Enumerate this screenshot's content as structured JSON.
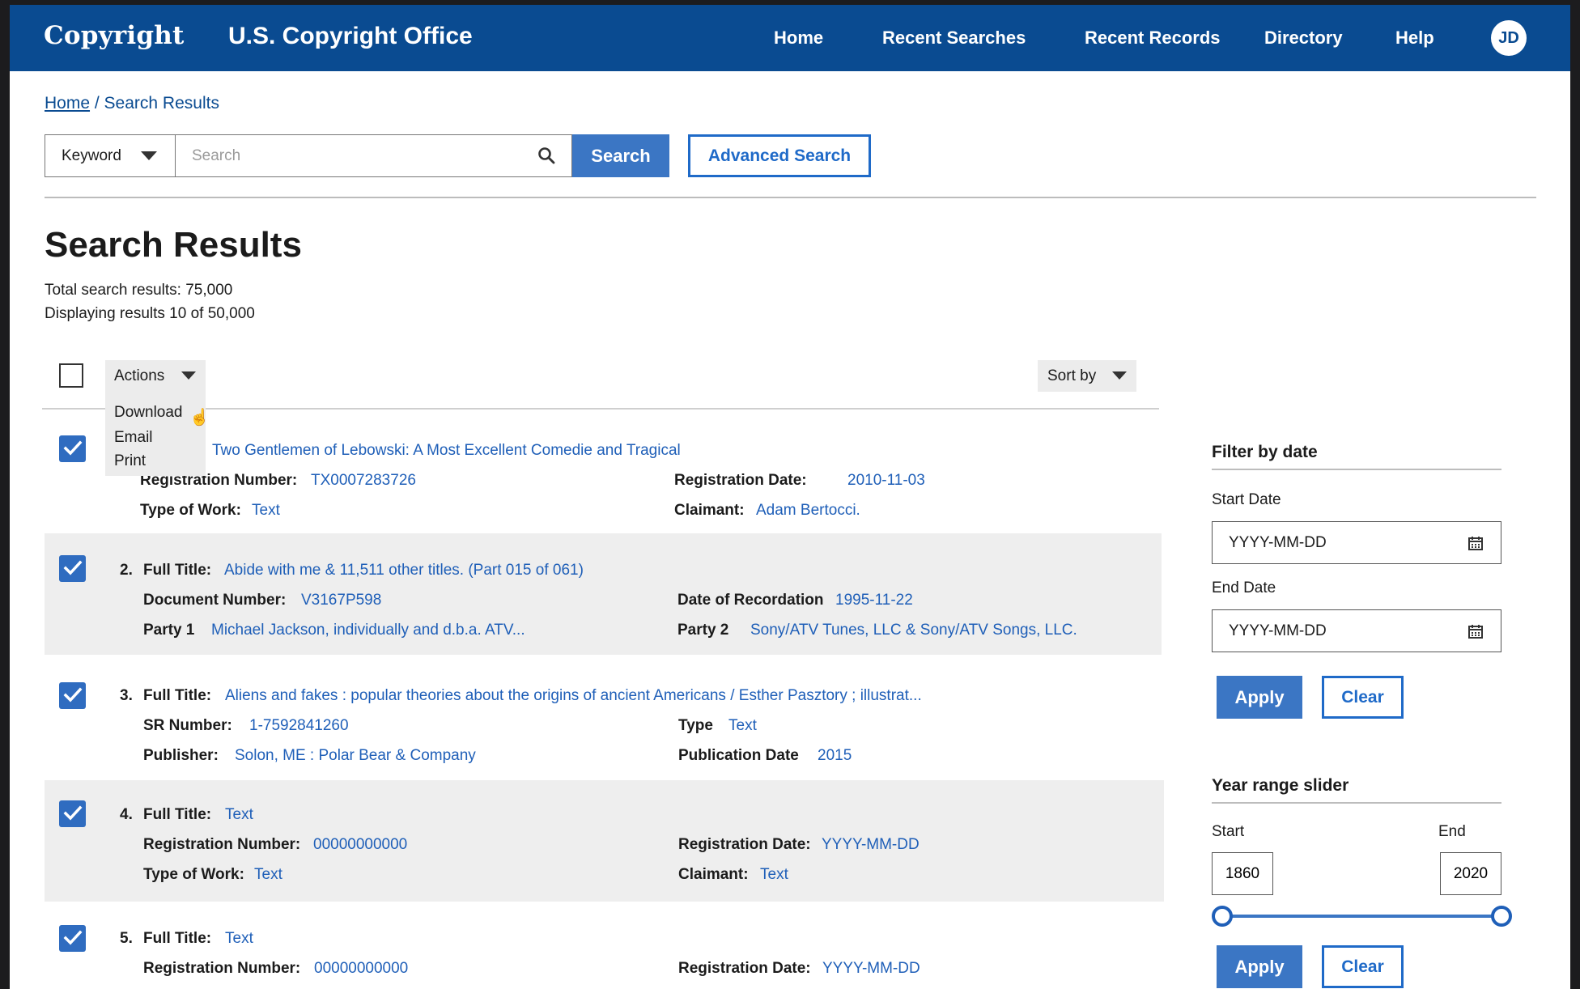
{
  "header": {
    "logo": "Copyright",
    "office": "U.S. Copyright Office",
    "nav": [
      "Home",
      "Recent Searches",
      "Recent Records",
      "Directory",
      "Help"
    ],
    "avatar": "JD",
    "color": "#0a4b91"
  },
  "breadcrumb": {
    "home": "Home",
    "current": "/ Search Results"
  },
  "search": {
    "type": "Keyword",
    "placeholder": "Search",
    "button": "Search",
    "advanced": "Advanced Search"
  },
  "page": {
    "title": "Search Results",
    "total": "Total search results: 75,000",
    "displaying": "Displaying results 10 of 50,000"
  },
  "toolbar": {
    "actions": "Actions",
    "menu": [
      "Download",
      "Email",
      "Print"
    ],
    "sort": "Sort by"
  },
  "results": [
    {
      "title": "Two Gentlemen of Lebowski: A Most Excellent Comedie and Tragical",
      "f1l": "Registration Number:",
      "f1v": "TX0007283726",
      "f2l": "Registration Date:",
      "f2v": "2010-11-03",
      "f3l": "Type of Work:",
      "f3v": "Text",
      "f4l": "Claimant:",
      "f4v": "Adam Bertocci."
    },
    {
      "num": "2.",
      "tl": "Full Title:",
      "title": "Abide with me & 11,511 other titles. (Part 015 of 061)",
      "f1l": "Document Number:",
      "f1v": "V3167P598",
      "f2l": "Date of Recordation",
      "f2v": "1995-11-22",
      "f3l": "Party 1",
      "f3v": "Michael Jackson, individually and d.b.a. ATV...",
      "f4l": "Party 2",
      "f4v": "Sony/ATV Tunes, LLC & Sony/ATV Songs, LLC."
    },
    {
      "num": "3.",
      "tl": "Full Title:",
      "title": "Aliens and fakes : popular theories about the origins of ancient Americans / Esther Pasztory ; illustrat...",
      "f1l": "SR Number:",
      "f1v": "1-7592841260",
      "f2l": "Type",
      "f2v": "Text",
      "f3l": "Publisher:",
      "f3v": "Solon, ME : Polar Bear & Company",
      "f4l": "Publication Date",
      "f4v": "2015"
    },
    {
      "num": "4.",
      "tl": "Full Title:",
      "title": "Text",
      "f1l": "Registration Number:",
      "f1v": "00000000000",
      "f2l": "Registration Date:",
      "f2v": "YYYY-MM-DD",
      "f3l": "Type of Work:",
      "f3v": "Text",
      "f4l": "Claimant:",
      "f4v": "Text"
    },
    {
      "num": "5.",
      "tl": "Full Title:",
      "title": "Text",
      "f1l": "Registration Number:",
      "f1v": "00000000000",
      "f2l": "Registration Date:",
      "f2v": "YYYY-MM-DD"
    }
  ],
  "filter_date": {
    "heading": "Filter by date",
    "start_label": "Start Date",
    "start_placeholder": "YYYY-MM-DD",
    "end_label": "End Date",
    "end_placeholder": "YYYY-MM-DD",
    "apply": "Apply",
    "clear": "Clear"
  },
  "year_slider": {
    "heading": "Year range slider",
    "start_label": "Start",
    "end_label": "End",
    "start": "1860",
    "end": "2020",
    "apply": "Apply",
    "clear": "Clear"
  }
}
